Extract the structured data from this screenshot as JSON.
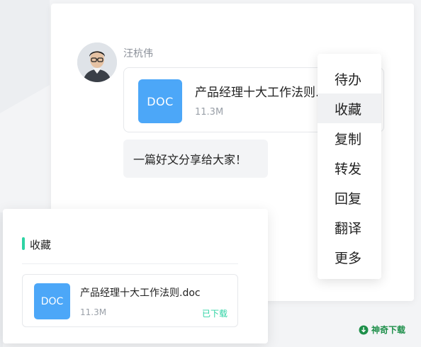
{
  "colors": {
    "doc_icon": "#4ca7f8",
    "accent": "#2ed3a4",
    "watermark": "#1e8f4a"
  },
  "chat": {
    "sender_name": "汪杭伟",
    "file_message": {
      "icon_label": "DOC",
      "file_name": "产品经理十大工作法则.doc",
      "file_size": "11.3M"
    },
    "text_message": "一篇好文分享给大家！"
  },
  "context_menu": {
    "items": [
      {
        "label": "待办"
      },
      {
        "label": "收藏"
      },
      {
        "label": "复制"
      },
      {
        "label": "转发"
      },
      {
        "label": "回复"
      },
      {
        "label": "翻译"
      },
      {
        "label": "更多"
      }
    ],
    "highlighted": "收藏"
  },
  "favorites_panel": {
    "title": "收藏",
    "file": {
      "icon_label": "DOC",
      "file_name": "产品经理十大工作法则.doc",
      "file_size": "11.3M",
      "status": "已下载"
    }
  },
  "watermark": {
    "text": "神奇下载",
    "icon": "download-arrow-icon"
  }
}
